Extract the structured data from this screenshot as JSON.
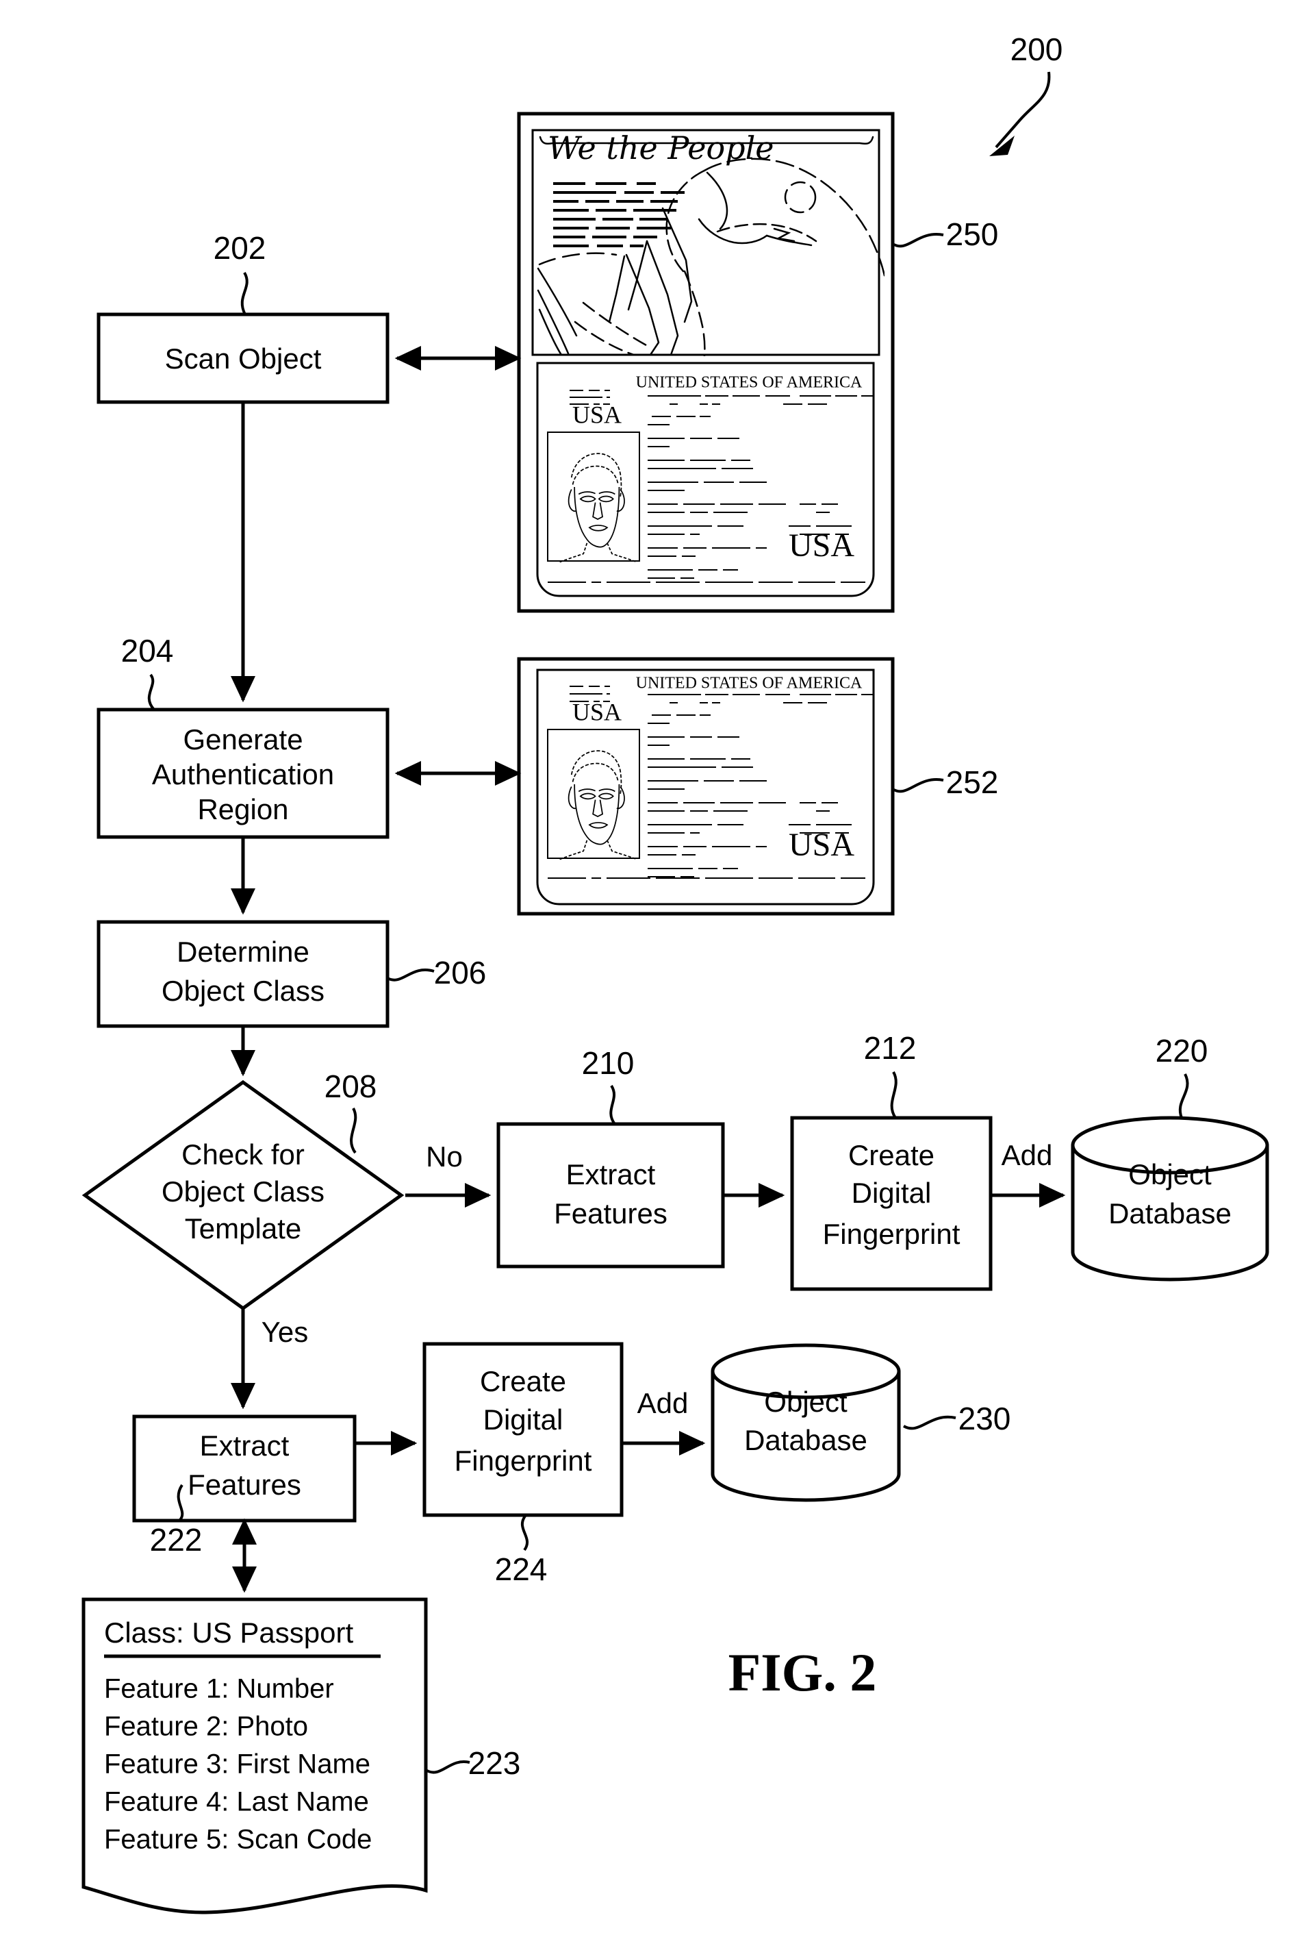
{
  "figure": {
    "label": "FIG. 2",
    "overall_ref": "200"
  },
  "flow": {
    "nodes": [
      {
        "id": "scan_object",
        "ref": "202",
        "label": "Scan Object",
        "shape": "process"
      },
      {
        "id": "generate_auth_region",
        "ref": "204",
        "label_line1": "Generate",
        "label_line2": "Authentication",
        "label_line3": "Region",
        "shape": "process"
      },
      {
        "id": "determine_object_class",
        "ref": "206",
        "label_line1": "Determine",
        "label_line2": "Object Class",
        "shape": "process"
      },
      {
        "id": "check_template",
        "ref": "208",
        "label_line1": "Check for",
        "label_line2": "Object Class",
        "label_line3": "Template",
        "shape": "decision"
      },
      {
        "id": "extract_features_no",
        "ref": "210",
        "label_line1": "Extract",
        "label_line2": "Features",
        "shape": "process"
      },
      {
        "id": "create_fingerprint_no",
        "ref": "212",
        "label_line1": "Create",
        "label_line2": "Digital",
        "label_line3": "Fingerprint",
        "shape": "process"
      },
      {
        "id": "object_database_no",
        "ref": "220",
        "label_line1": "Object",
        "label_line2": "Database",
        "shape": "cylinder"
      },
      {
        "id": "extract_features_yes",
        "ref": "222",
        "label_line1": "Extract",
        "label_line2": "Features",
        "shape": "process"
      },
      {
        "id": "create_fingerprint_yes",
        "ref": "224",
        "label_line1": "Create",
        "label_line2": "Digital",
        "label_line3": "Fingerprint",
        "shape": "process"
      },
      {
        "id": "object_database_yes",
        "ref": "230",
        "label_line1": "Object",
        "label_line2": "Database",
        "shape": "cylinder"
      },
      {
        "id": "class_template_doc",
        "ref": "223",
        "shape": "document"
      }
    ],
    "edge_labels": {
      "no": "No",
      "yes": "Yes",
      "add_upper": "Add",
      "add_lower": "Add"
    }
  },
  "template_document": {
    "title": "Class: US Passport",
    "features": [
      "Feature 1: Number",
      "Feature 2: Photo",
      "Feature 3: First Name",
      "Feature 4: Last Name",
      "Feature 5: Scan Code"
    ]
  },
  "passport_open": {
    "ref": "250",
    "script_text": "We the People",
    "caption": "UNITED STATES OF AMERICA",
    "usa_small": "USA",
    "usa_large": "USA"
  },
  "passport_page": {
    "ref": "252",
    "caption": "UNITED STATES OF AMERICA",
    "usa_small": "USA",
    "usa_large": "USA"
  },
  "colors": {
    "ink": "#000000",
    "paper": "#ffffff"
  }
}
